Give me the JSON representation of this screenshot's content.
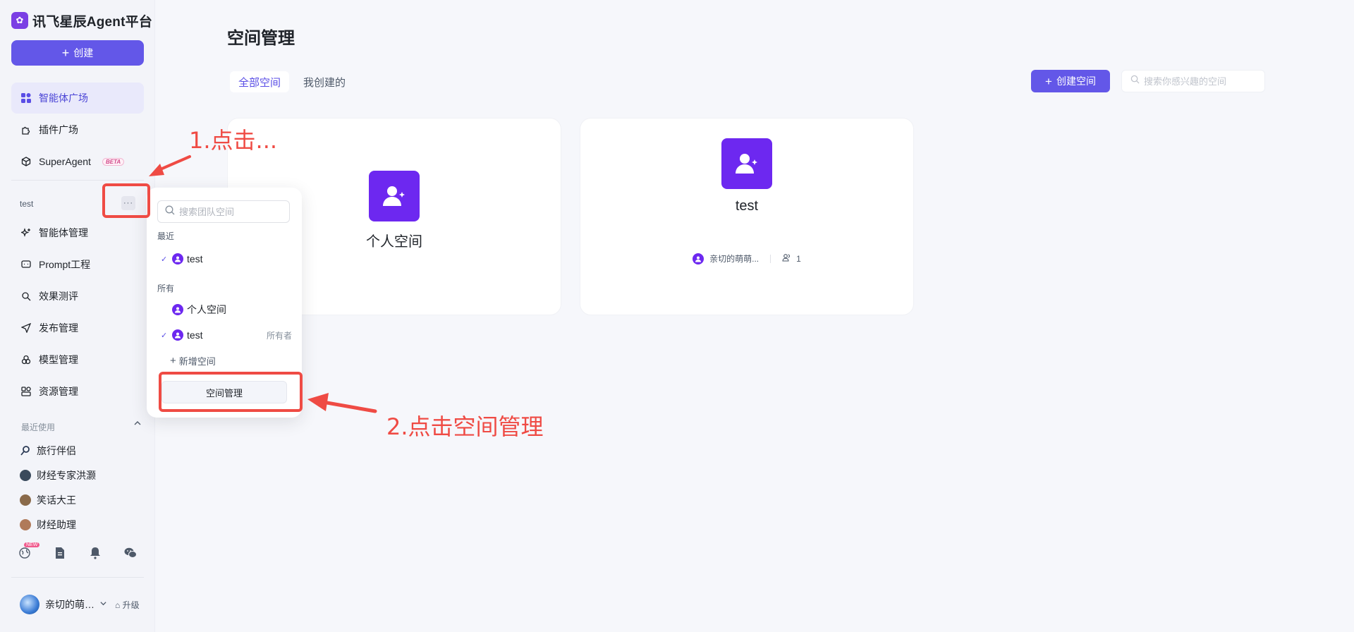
{
  "brand": {
    "logo_glyph": "✿",
    "name": "讯飞星辰Agent平台"
  },
  "sidebar": {
    "create_label": "创建",
    "nav_top": [
      {
        "label": "智能体广场",
        "icon": "grid-icon",
        "active": true
      },
      {
        "label": "插件广场",
        "icon": "puzzle-icon",
        "active": false
      },
      {
        "label": "SuperAgent",
        "icon": "cube-icon",
        "active": false,
        "badge": "BETA"
      }
    ],
    "team_name": "test",
    "more_glyph": "···",
    "nav_team": [
      {
        "label": "智能体管理",
        "icon": "sparkle-icon"
      },
      {
        "label": "Prompt工程",
        "icon": "prompt-icon"
      },
      {
        "label": "效果测评",
        "icon": "evaluate-icon"
      },
      {
        "label": "发布管理",
        "icon": "send-icon"
      },
      {
        "label": "模型管理",
        "icon": "model-icon"
      },
      {
        "label": "资源管理",
        "icon": "resource-icon"
      }
    ],
    "recent_label": "最近使用",
    "recent_items": [
      {
        "label": "旅行伴侣",
        "color": "#2b6cb0"
      },
      {
        "label": "财经专家洪灏",
        "color": "#3a4a5c"
      },
      {
        "label": "笑话大王",
        "color": "#8a6a4a"
      },
      {
        "label": "财经助理",
        "color": "#b07a5a"
      }
    ],
    "bottom_new_tag": "NEW",
    "user_name": "亲切的萌…",
    "upgrade_label": "升级"
  },
  "main": {
    "title": "空间管理",
    "tabs": [
      "全部空间",
      "我创建的"
    ],
    "create_space_label": "创建空间",
    "search_placeholder": "搜索你感兴趣的空间",
    "cards": [
      {
        "title": "个人空间"
      },
      {
        "title": "test",
        "owner": "亲切的萌萌...",
        "members": "1"
      }
    ]
  },
  "popup": {
    "search_placeholder": "搜索团队空间",
    "recent_label": "最近",
    "recent_items": [
      "test"
    ],
    "all_label": "所有",
    "all_items": [
      {
        "label": "个人空间",
        "checked": false,
        "role": ""
      },
      {
        "label": "test",
        "checked": true,
        "role": "所有者"
      }
    ],
    "add_space_label": "新增空间",
    "manage_label": "空间管理"
  },
  "annotations": {
    "step1": "1.点击...",
    "step2": "2.点击空间管理",
    "color": "#ef4b44"
  },
  "colors": {
    "accent": "#6357e8",
    "space_icon": "#6d28f0"
  }
}
